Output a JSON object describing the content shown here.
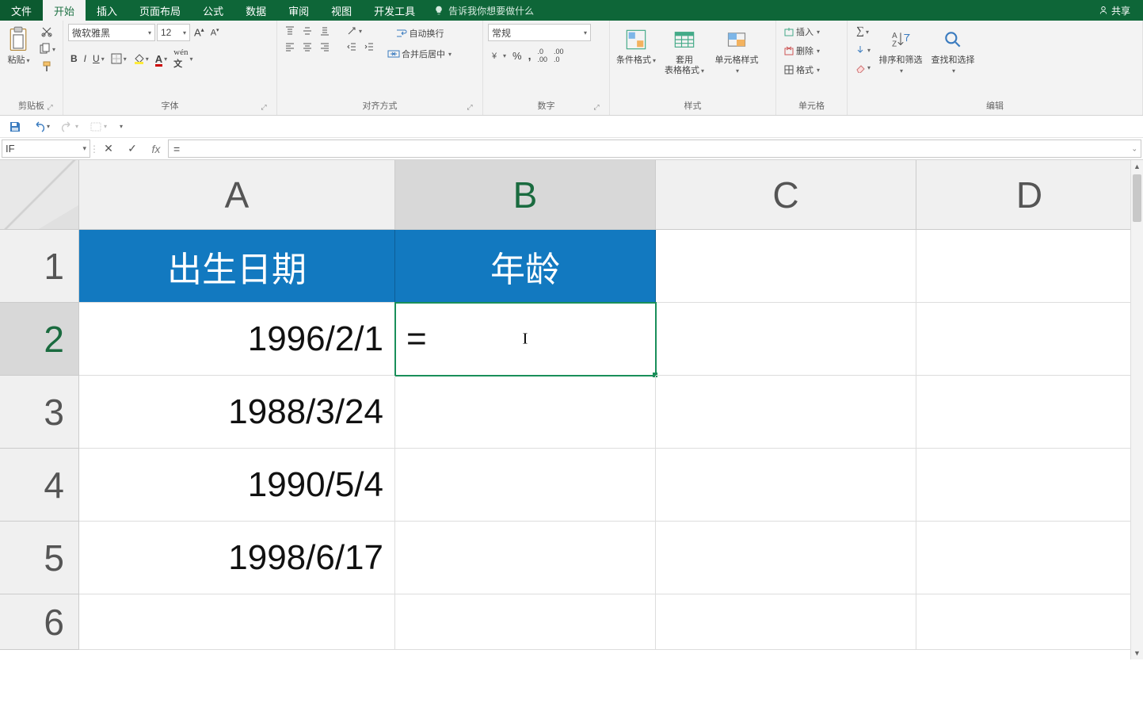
{
  "tabs": {
    "file": "文件",
    "home": "开始",
    "insert": "插入",
    "layout": "页面布局",
    "formulas": "公式",
    "data": "数据",
    "review": "审阅",
    "view": "视图",
    "dev": "开发工具",
    "tellme": "告诉我你想要做什么"
  },
  "share": "共享",
  "ribbon": {
    "clipboard": {
      "paste": "粘贴",
      "label": "剪贴板"
    },
    "font": {
      "name": "微软雅黑",
      "size": "12",
      "label": "字体",
      "bold": "B",
      "italic": "I",
      "underline": "U"
    },
    "align": {
      "wrap": "自动换行",
      "merge": "合并后居中",
      "label": "对齐方式"
    },
    "number": {
      "format": "常规",
      "label": "数字"
    },
    "styles": {
      "cond": "条件格式",
      "table": "套用\n表格格式",
      "cell": "单元格样式",
      "label": "样式"
    },
    "cells": {
      "insert": "插入",
      "delete": "删除",
      "format": "格式",
      "label": "单元格"
    },
    "editing": {
      "sort": "排序和筛选",
      "find": "查找和选择",
      "label": "编辑"
    }
  },
  "namebox": "IF",
  "formula": "=",
  "columns": [
    "A",
    "B",
    "C",
    "D"
  ],
  "rows": [
    "1",
    "2",
    "3",
    "4",
    "5",
    "6"
  ],
  "headers": {
    "A": "出生日期",
    "B": "年龄"
  },
  "dataA": [
    "1996/2/1",
    "1988/3/24",
    "1990/5/4",
    "1998/6/17"
  ],
  "editingCell": "="
}
